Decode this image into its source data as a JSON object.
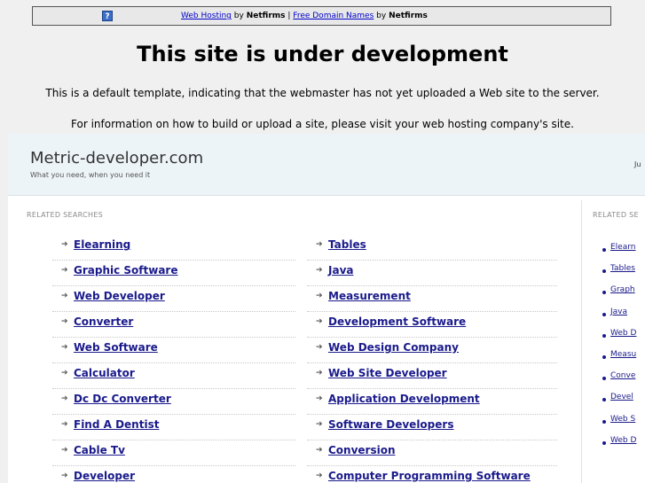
{
  "topbar": {
    "link1": "Web Hosting",
    "by1": "by",
    "brand1": "Netfirms",
    "sep": "|",
    "link2": "Free Domain Names",
    "by2": "by",
    "brand2": "Netfirms",
    "icon_glyph": "?"
  },
  "notice": {
    "title": "This site is under development",
    "line1": "This is a default template, indicating that the webmaster has not yet uploaded a Web site to the server.",
    "line2": "For information on how to build or upload a site, please visit your web hosting company's site."
  },
  "site": {
    "name": "Metric-developer.com",
    "tagline": "What you need, when you need it",
    "corner_text": "Ju"
  },
  "related_heading": "RELATED SEARCHES",
  "side_heading": "RELATED SE",
  "left_links": [
    "Elearning",
    "Graphic Software",
    "Web Developer",
    "Converter",
    "Web Software",
    "Calculator",
    "Dc Dc Converter",
    "Find A Dentist",
    "Cable Tv",
    "Developer"
  ],
  "right_links": [
    "Tables",
    "Java",
    "Measurement",
    "Development Software",
    "Web Design Company",
    "Web Site Developer",
    "Application Development",
    "Software Developers",
    "Conversion",
    "Computer Programming Software"
  ],
  "side_links": [
    "Elearn",
    "Tables",
    "Graph",
    "Java",
    "Web D",
    "Measu",
    "Conve",
    "Devel",
    "Web S",
    "Web D"
  ]
}
